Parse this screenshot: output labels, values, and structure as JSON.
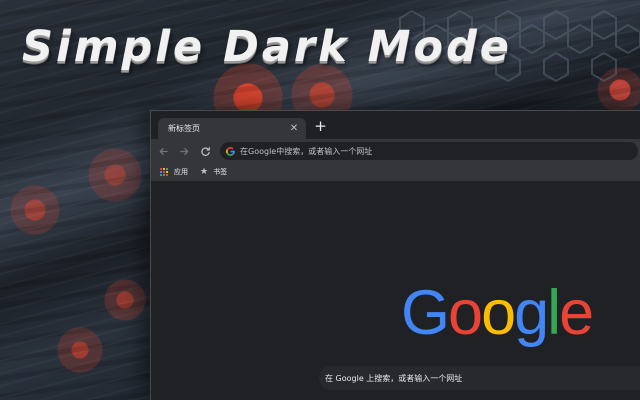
{
  "promo": {
    "title": "Simple Dark Mode"
  },
  "browser": {
    "tab": {
      "title": "新标签页",
      "close_icon": "close-icon"
    },
    "new_tab_icon": "plus-icon",
    "toolbar": {
      "back_icon": "back-arrow-icon",
      "forward_icon": "forward-arrow-icon",
      "reload_icon": "reload-icon",
      "omnibox": {
        "placeholder": "在Google中搜索，或者输入一个网址",
        "icon": "google-g-icon"
      }
    },
    "bookmarks_bar": {
      "items": [
        {
          "label": "应用",
          "icon": "apps-grid-icon"
        },
        {
          "label": "书签",
          "icon": "star-icon"
        }
      ]
    },
    "new_tab_page": {
      "logo_letters": [
        {
          "char": "G",
          "color": "#4285F4"
        },
        {
          "char": "o",
          "color": "#EA4335"
        },
        {
          "char": "o",
          "color": "#FBBC05"
        },
        {
          "char": "g",
          "color": "#4285F4"
        },
        {
          "char": "l",
          "color": "#34A853"
        },
        {
          "char": "e",
          "color": "#EA4335"
        }
      ],
      "search_placeholder": "在 Google 上搜索，或者输入一个网址"
    }
  },
  "colors": {
    "tabstrip_background": "#1f2023",
    "toolbar_background": "#35363a",
    "omnibox_background": "#202124",
    "page_background": "#202124",
    "text_primary": "#e8eaed",
    "text_secondary": "#bdc1c6"
  }
}
